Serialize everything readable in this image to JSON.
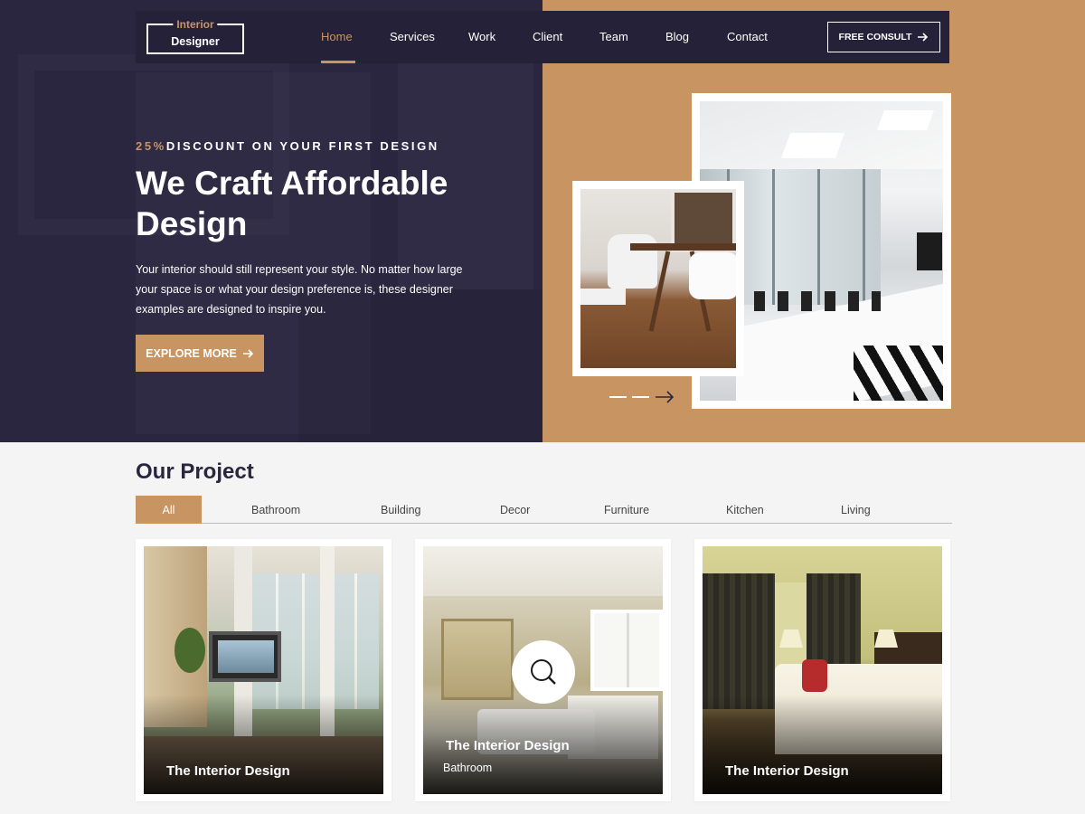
{
  "brand": {
    "logo_line1": "Interior",
    "logo_line2": "Designer",
    "accent_color": "#c89462",
    "dark_color": "#2b2640"
  },
  "nav": {
    "items": [
      {
        "label": "Home",
        "active": true
      },
      {
        "label": "Services",
        "active": false
      },
      {
        "label": "Work",
        "active": false
      },
      {
        "label": "Client",
        "active": false
      },
      {
        "label": "Team",
        "active": false
      },
      {
        "label": "Blog",
        "active": false
      },
      {
        "label": "Contact",
        "active": false
      }
    ],
    "cta_label": "FREE CONSULT",
    "cta_icon": "arrow-right-icon"
  },
  "hero": {
    "discount_value": "25%",
    "discount_text": "DISCOUNT ON YOUR FIRST DESIGN",
    "headline": "We Craft Affordable Design",
    "description": "Your interior should still represent your style. No matter how large your space is or what your design preference is, these designer examples are designed to inspire you.",
    "button_label": "EXPLORE MORE",
    "button_icon": "arrow-right-icon"
  },
  "projects": {
    "title": "Our Project",
    "tabs": [
      {
        "label": "All",
        "active": true
      },
      {
        "label": "Bathroom",
        "active": false
      },
      {
        "label": "Building",
        "active": false
      },
      {
        "label": "Decor",
        "active": false
      },
      {
        "label": "Furniture",
        "active": false
      },
      {
        "label": "Kitchen",
        "active": false
      },
      {
        "label": "Living",
        "active": false
      }
    ],
    "cards": [
      {
        "title": "The Interior Design",
        "category": ""
      },
      {
        "title": "The Interior Design",
        "category": "Bathroom",
        "hover_icon": "search-icon"
      },
      {
        "title": "The Interior Design",
        "category": ""
      }
    ]
  }
}
